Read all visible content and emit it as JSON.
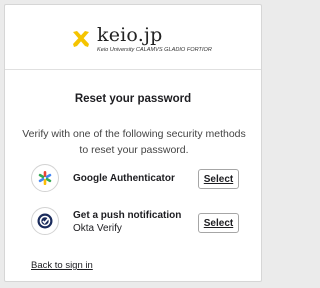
{
  "header": {
    "logo_text": "keio.jp",
    "logo_subtitle": "Keio University CALAMVS GLADIO FORTIOR",
    "logo_icon": "crossed-pens-icon",
    "brand_color": "#f5c400"
  },
  "main": {
    "title": "Reset your password",
    "description": "Verify with one of the following security methods to reset your password.",
    "factors": [
      {
        "name": "Google Authenticator",
        "sub": "",
        "icon": "google-authenticator-icon",
        "button_label": "Select"
      },
      {
        "name": "Get a push notification",
        "sub": "Okta Verify",
        "icon": "okta-verify-icon",
        "button_label": "Select"
      }
    ],
    "back_link": "Back to sign in"
  }
}
